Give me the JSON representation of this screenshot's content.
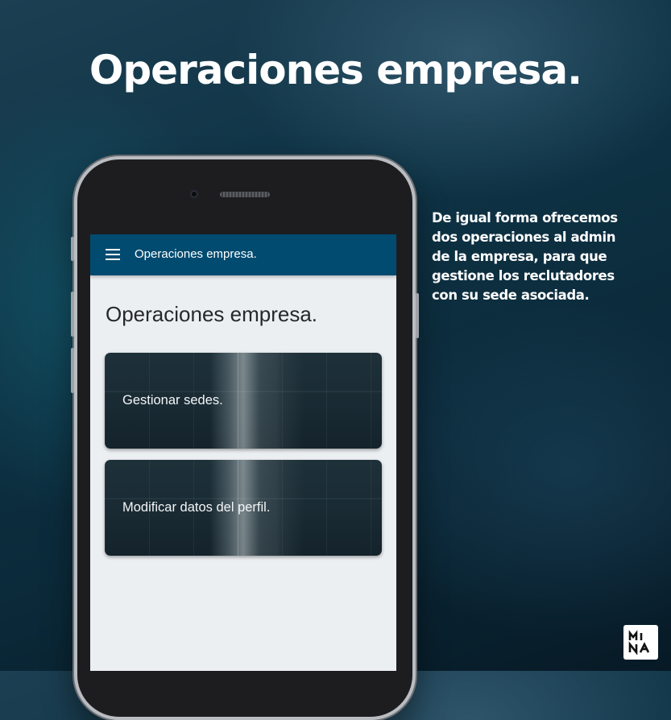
{
  "promo": {
    "headline": "Operaciones empresa.",
    "description": "De igual forma ofrecemos dos operaciones al admin de la empresa, para que gestione los reclutadores con su sede asociada.",
    "logo_text": "MINA"
  },
  "app": {
    "app_bar": {
      "title": "Operaciones empresa.",
      "menu_icon": "hamburger-menu-icon"
    },
    "page_title": "Operaciones empresa.",
    "cards": [
      {
        "label": "Gestionar sedes."
      },
      {
        "label": "Modificar datos del perfil."
      }
    ],
    "colors": {
      "app_bar": "#024b70",
      "screen_background": "#eceff2",
      "card_text": "#f3f5f6"
    }
  }
}
